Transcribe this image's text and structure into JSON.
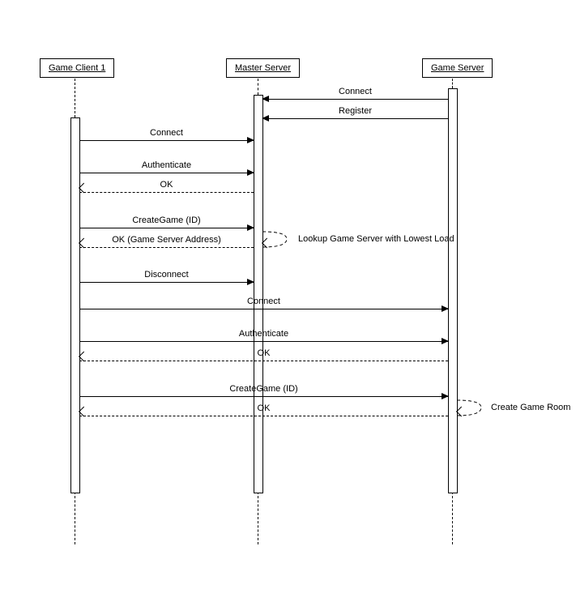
{
  "participants": {
    "client": "Game Client 1",
    "master": "Master Server",
    "game": "Game Server"
  },
  "messages": {
    "gs_connect": "Connect",
    "gs_register": "Register",
    "c_connect": "Connect",
    "c_auth": "Authenticate",
    "c_auth_ok": "OK",
    "c_create": "CreateGame (ID)",
    "m_lookup": "Lookup Game Server with Lowest Load",
    "c_create_ok": "OK (Game Server Address)",
    "c_disconnect": "Disconnect",
    "c_connect2": "Connect",
    "c_auth2": "Authenticate",
    "c_auth2_ok": "OK",
    "c_create2": "CreateGame (ID)",
    "gs_room": "Create Game Room",
    "c_create2_ok": "OK"
  },
  "chart_data": {
    "type": "sequence-diagram",
    "participants": [
      "Game Client 1",
      "Master Server",
      "Game Server"
    ],
    "interactions": [
      {
        "from": "Game Server",
        "to": "Master Server",
        "label": "Connect",
        "kind": "sync"
      },
      {
        "from": "Game Server",
        "to": "Master Server",
        "label": "Register",
        "kind": "sync"
      },
      {
        "from": "Game Client 1",
        "to": "Master Server",
        "label": "Connect",
        "kind": "sync"
      },
      {
        "from": "Game Client 1",
        "to": "Master Server",
        "label": "Authenticate",
        "kind": "sync"
      },
      {
        "from": "Master Server",
        "to": "Game Client 1",
        "label": "OK",
        "kind": "return"
      },
      {
        "from": "Game Client 1",
        "to": "Master Server",
        "label": "CreateGame (ID)",
        "kind": "sync"
      },
      {
        "from": "Master Server",
        "to": "Master Server",
        "label": "Lookup Game Server with Lowest Load",
        "kind": "self"
      },
      {
        "from": "Master Server",
        "to": "Game Client 1",
        "label": "OK (Game Server Address)",
        "kind": "return"
      },
      {
        "from": "Game Client 1",
        "to": "Master Server",
        "label": "Disconnect",
        "kind": "sync"
      },
      {
        "from": "Game Client 1",
        "to": "Game Server",
        "label": "Connect",
        "kind": "sync"
      },
      {
        "from": "Game Client 1",
        "to": "Game Server",
        "label": "Authenticate",
        "kind": "sync"
      },
      {
        "from": "Game Server",
        "to": "Game Client 1",
        "label": "OK",
        "kind": "return"
      },
      {
        "from": "Game Client 1",
        "to": "Game Server",
        "label": "CreateGame (ID)",
        "kind": "sync"
      },
      {
        "from": "Game Server",
        "to": "Game Server",
        "label": "Create Game Room",
        "kind": "self"
      },
      {
        "from": "Game Server",
        "to": "Game Client 1",
        "label": "OK",
        "kind": "return"
      }
    ]
  }
}
